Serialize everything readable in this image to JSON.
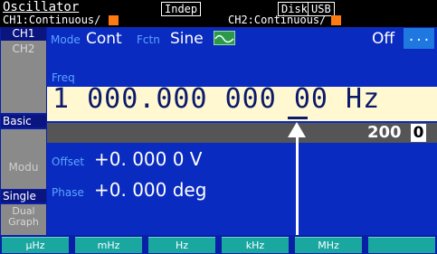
{
  "header": {
    "title": "Oscillator",
    "indep": "Indep",
    "disk": "Disk",
    "usb": "USB",
    "ch1_status": "CH1:Continuous/",
    "ch2_status": "CH2:Continuous/"
  },
  "sidebar": {
    "ch1": "CH1",
    "ch2": "CH2",
    "basic": "Basic",
    "modu": "Modu",
    "single": "Single",
    "dual": "Dual",
    "graph": "Graph"
  },
  "mode": {
    "mode_label": "Mode",
    "mode_value": "Cont",
    "fctn_label": "Fctn",
    "fctn_value": "Sine",
    "output": "Off",
    "more": "..."
  },
  "freq": {
    "label": "Freq",
    "value": "1 000.000 000 00 Hz",
    "step": "200",
    "step_digit": "0"
  },
  "offset": {
    "label": "Offset",
    "value": "+0. 000 0 V"
  },
  "phase": {
    "label": "Phase",
    "value": "+0. 000 deg"
  },
  "softkeys": [
    "μHz",
    "mHz",
    "Hz",
    "kHz",
    "MHz"
  ],
  "colors": {
    "panel": "#0a2bc0",
    "freq_bg": "#fff8d0",
    "softkey": "#1aa7a0",
    "accent_orange": "#ff7a10"
  }
}
